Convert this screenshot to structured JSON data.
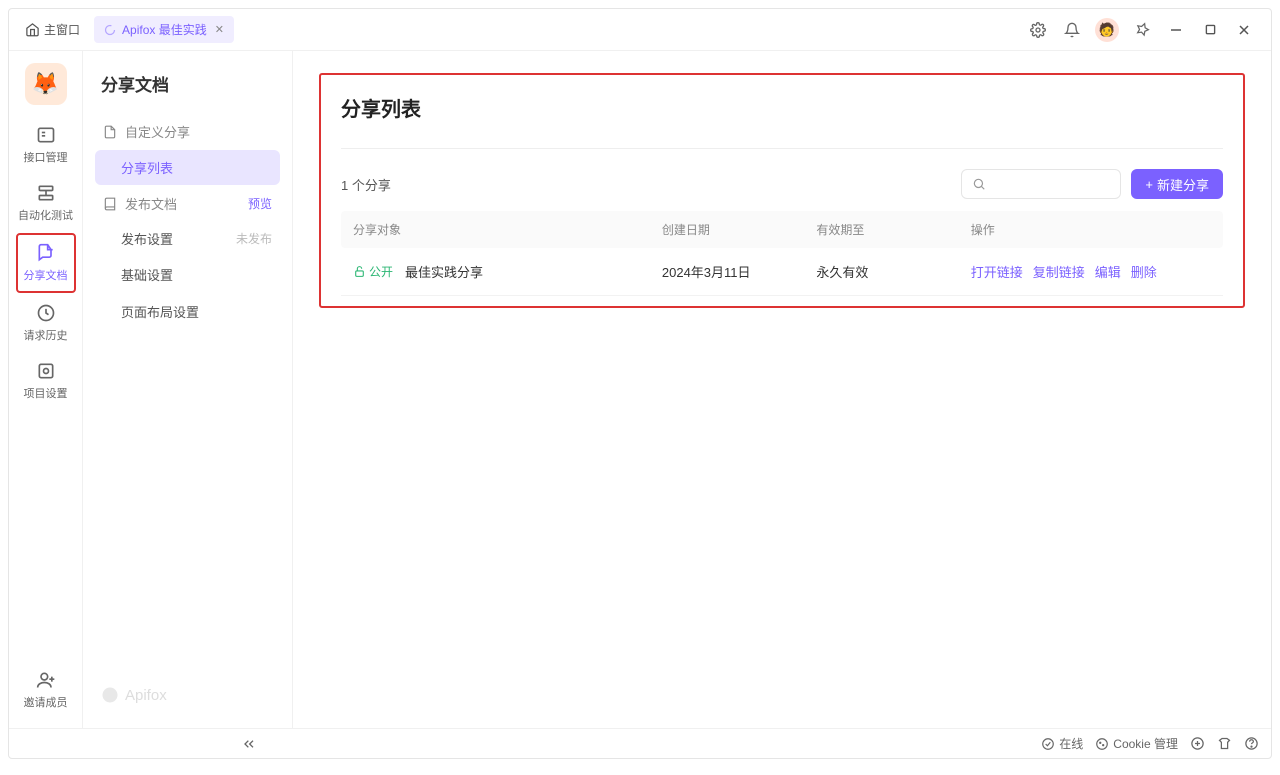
{
  "titlebar": {
    "home": "主窗口",
    "tab_label": "Apifox 最佳实践"
  },
  "rail": {
    "api_management": "接口管理",
    "automation_test": "自动化测试",
    "share_docs": "分享文档",
    "request_history": "请求历史",
    "project_settings": "项目设置",
    "invite_members": "邀请成员"
  },
  "sidebar": {
    "title": "分享文档",
    "custom_share": "自定义分享",
    "share_list": "分享列表",
    "publish_docs": "发布文档",
    "preview": "预览",
    "publish_settings": "发布设置",
    "unpublished": "未发布",
    "basic_settings": "基础设置",
    "page_layout_settings": "页面布局设置",
    "brand": "Apifox"
  },
  "main": {
    "page_title": "分享列表",
    "count_text": "1 个分享",
    "new_button": "新建分享",
    "columns": {
      "target": "分享对象",
      "created": "创建日期",
      "valid_until": "有效期至",
      "operations": "操作"
    },
    "rows": [
      {
        "visibility": "公开",
        "name": "最佳实践分享",
        "created": "2024年3月11日",
        "valid_until": "永久有效",
        "ops": {
          "open_link": "打开链接",
          "copy_link": "复制链接",
          "edit": "编辑",
          "delete": "删除"
        }
      }
    ]
  },
  "statusbar": {
    "online": "在线",
    "cookie_mgmt": "Cookie 管理"
  }
}
